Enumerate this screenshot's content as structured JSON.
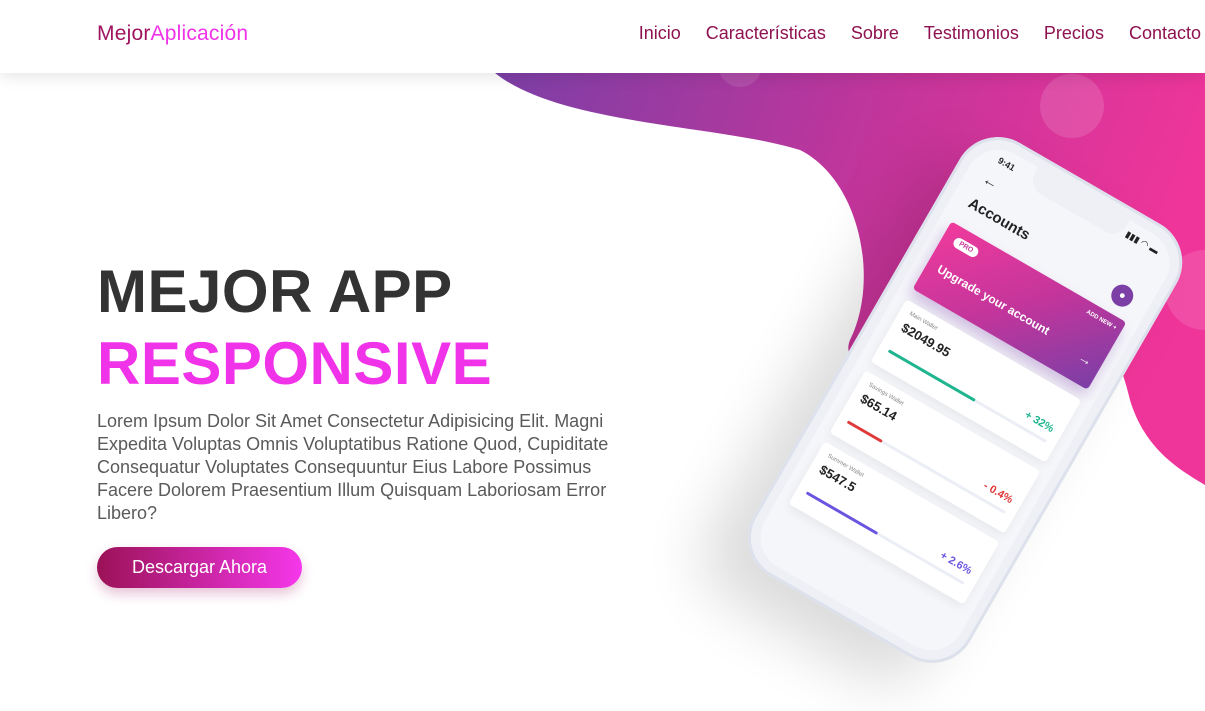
{
  "brand": {
    "part1": "Mejor",
    "part2": "Aplicación"
  },
  "nav": {
    "items": [
      {
        "label": "Inicio",
        "name": "nav-inicio"
      },
      {
        "label": "Características",
        "name": "nav-caracteristicas"
      },
      {
        "label": "Sobre",
        "name": "nav-sobre"
      },
      {
        "label": "Testimonios",
        "name": "nav-testimonios"
      },
      {
        "label": "Precios",
        "name": "nav-precios"
      },
      {
        "label": "Contacto",
        "name": "nav-contacto"
      }
    ]
  },
  "hero": {
    "title": "MEJOR APP",
    "subtitle": "RESPONSIVE",
    "text": "Lorem Ipsum Dolor Sit Amet Consectetur Adipisicing Elit. Magni Expedita Voluptas Omnis Voluptatibus Ratione Quod, Cupiditate Consequatur Voluptates Consequuntur Eius Labore Possimus Facere Dolorem Praesentium Illum Quisquam Laboriosam Error Libero?",
    "cta": "Descargar Ahora"
  },
  "phone": {
    "time": "9:41",
    "status": "▮▮▮ ◠ ▬",
    "back": "←",
    "title": "Accounts",
    "avatar_icon": "user-icon",
    "upgrade": {
      "badge": "PRO",
      "add_new": "ADD NEW +",
      "text": "Upgrade your account",
      "arrow": "→"
    },
    "wallets": [
      {
        "label": "Main Wallet",
        "amount": "$2049.95",
        "change": "+ 32%",
        "color": "#1fb58f",
        "fill": 0.55
      },
      {
        "label": "Savings Wallet",
        "amount": "$65.14",
        "change": "- 0.4%",
        "color": "#e03a3a",
        "fill": 0.22
      },
      {
        "label": "Summer Wallet",
        "amount": "$547.5",
        "change": "+ 2.6%",
        "color": "#6a55e0",
        "fill": 0.45
      }
    ]
  },
  "colors": {
    "brand_dark": "#a0135f",
    "brand_pink": "#f033e8",
    "gradient_start": "#7b3fa6",
    "gradient_end": "#f0359a"
  }
}
